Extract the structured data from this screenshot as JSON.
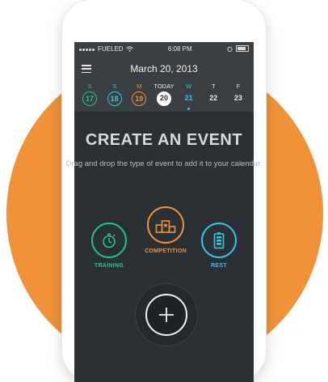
{
  "status": {
    "carrier": "FUELED",
    "time": "6:08 PM"
  },
  "header": {
    "date": "March 20, 2013"
  },
  "week": [
    {
      "name": "S",
      "num": "17"
    },
    {
      "name": "S",
      "num": "18"
    },
    {
      "name": "M",
      "num": "19"
    },
    {
      "name": "TODAY",
      "num": "20"
    },
    {
      "name": "W",
      "num": "21"
    },
    {
      "name": "T",
      "num": "22"
    },
    {
      "name": "F",
      "num": "23"
    }
  ],
  "main": {
    "title": "CREATE AN EVENT",
    "subtitle": "Drag and drop the type of event to add it to your calendar."
  },
  "events": {
    "training": "TRAINING",
    "competition": "COMPETITION",
    "rest": "REST"
  },
  "colors": {
    "background_circle": "#F0923A",
    "training": "#27C28E",
    "rest": "#36C8E3",
    "competition": "#F0923A",
    "screen": "#2b3035"
  }
}
